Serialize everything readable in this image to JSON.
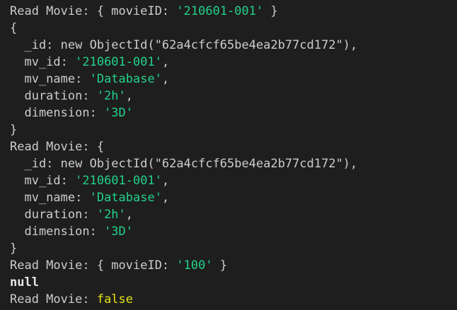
{
  "colors": {
    "background": "#1e1e1e",
    "text": "#cccccc",
    "string": "#23d18b",
    "boolean": "#e5e510",
    "bold_text": "#e6e6e6"
  },
  "terminal": {
    "output_1": {
      "label_prefix": "Read Movie: { movieID: ",
      "label_id": "'210601-001'",
      "label_suffix": " }",
      "open_brace": "{",
      "id_line": "  _id: new ObjectId(\"62a4cfcf65be4ea2b77cd172\"),",
      "mv_id_key": "  mv_id: ",
      "mv_id_val": "'210601-001'",
      "mv_id_comma": ",",
      "mv_name_key": "  mv_name: ",
      "mv_name_val": "'Database'",
      "mv_name_comma": ",",
      "duration_key": "  duration: ",
      "duration_val": "'2h'",
      "duration_comma": ",",
      "dimension_key": "  dimension: ",
      "dimension_val": "'3D'",
      "close_brace": "}"
    },
    "output_2": {
      "label_open": "Read Movie: {",
      "id_line": "  _id: new ObjectId(\"62a4cfcf65be4ea2b77cd172\"),",
      "mv_id_key": "  mv_id: ",
      "mv_id_val": "'210601-001'",
      "mv_id_comma": ",",
      "mv_name_key": "  mv_name: ",
      "mv_name_val": "'Database'",
      "mv_name_comma": ",",
      "duration_key": "  duration: ",
      "duration_val": "'2h'",
      "duration_comma": ",",
      "dimension_key": "  dimension: ",
      "dimension_val": "'3D'",
      "close_brace": "}"
    },
    "output_3": {
      "label_prefix": "Read Movie: { movieID: ",
      "label_id": "'100'",
      "label_suffix": " }",
      "null_value": "null"
    },
    "output_4": {
      "label_prefix": "Read Movie: ",
      "result": "false"
    }
  }
}
